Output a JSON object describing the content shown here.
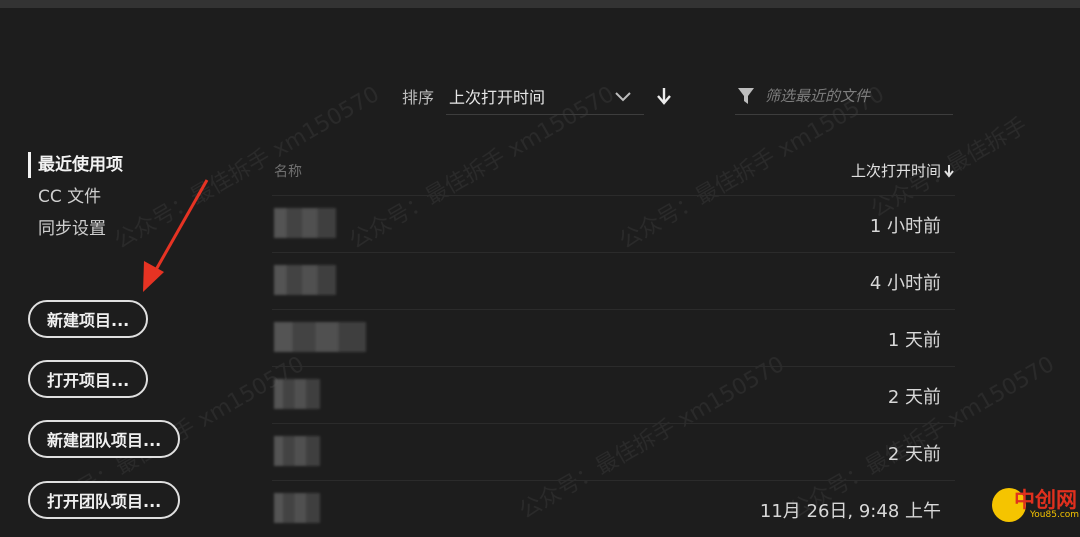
{
  "sort": {
    "label": "排序",
    "value": "上次打开时间"
  },
  "filter": {
    "placeholder": "筛选最近的文件"
  },
  "sidebar": {
    "items": [
      {
        "label": "最近使用项"
      },
      {
        "label": "CC 文件"
      },
      {
        "label": "同步设置"
      }
    ],
    "buttons": {
      "new_project": "新建项目...",
      "open_project": "打开项目...",
      "new_team_project": "新建团队项目...",
      "open_team_project": "打开团队项目..."
    }
  },
  "table": {
    "col_name": "名称",
    "col_time": "上次打开时间",
    "rows": [
      {
        "time": "1 小时前"
      },
      {
        "time": "4 小时前"
      },
      {
        "time": "1 天前"
      },
      {
        "time": "2 天前"
      },
      {
        "time": "2 天前"
      },
      {
        "time": "11月 26日, 9:48 上午"
      }
    ]
  },
  "watermark": {
    "text": "公众号：最佳拆手",
    "sub": "xm150570"
  },
  "logo": {
    "text": "中创网",
    "sub": "You85.com"
  },
  "colors": {
    "background": "#1d1d1d",
    "arrow": "#e63323",
    "logo_yellow": "#f5c400",
    "logo_red": "#e0301e"
  }
}
